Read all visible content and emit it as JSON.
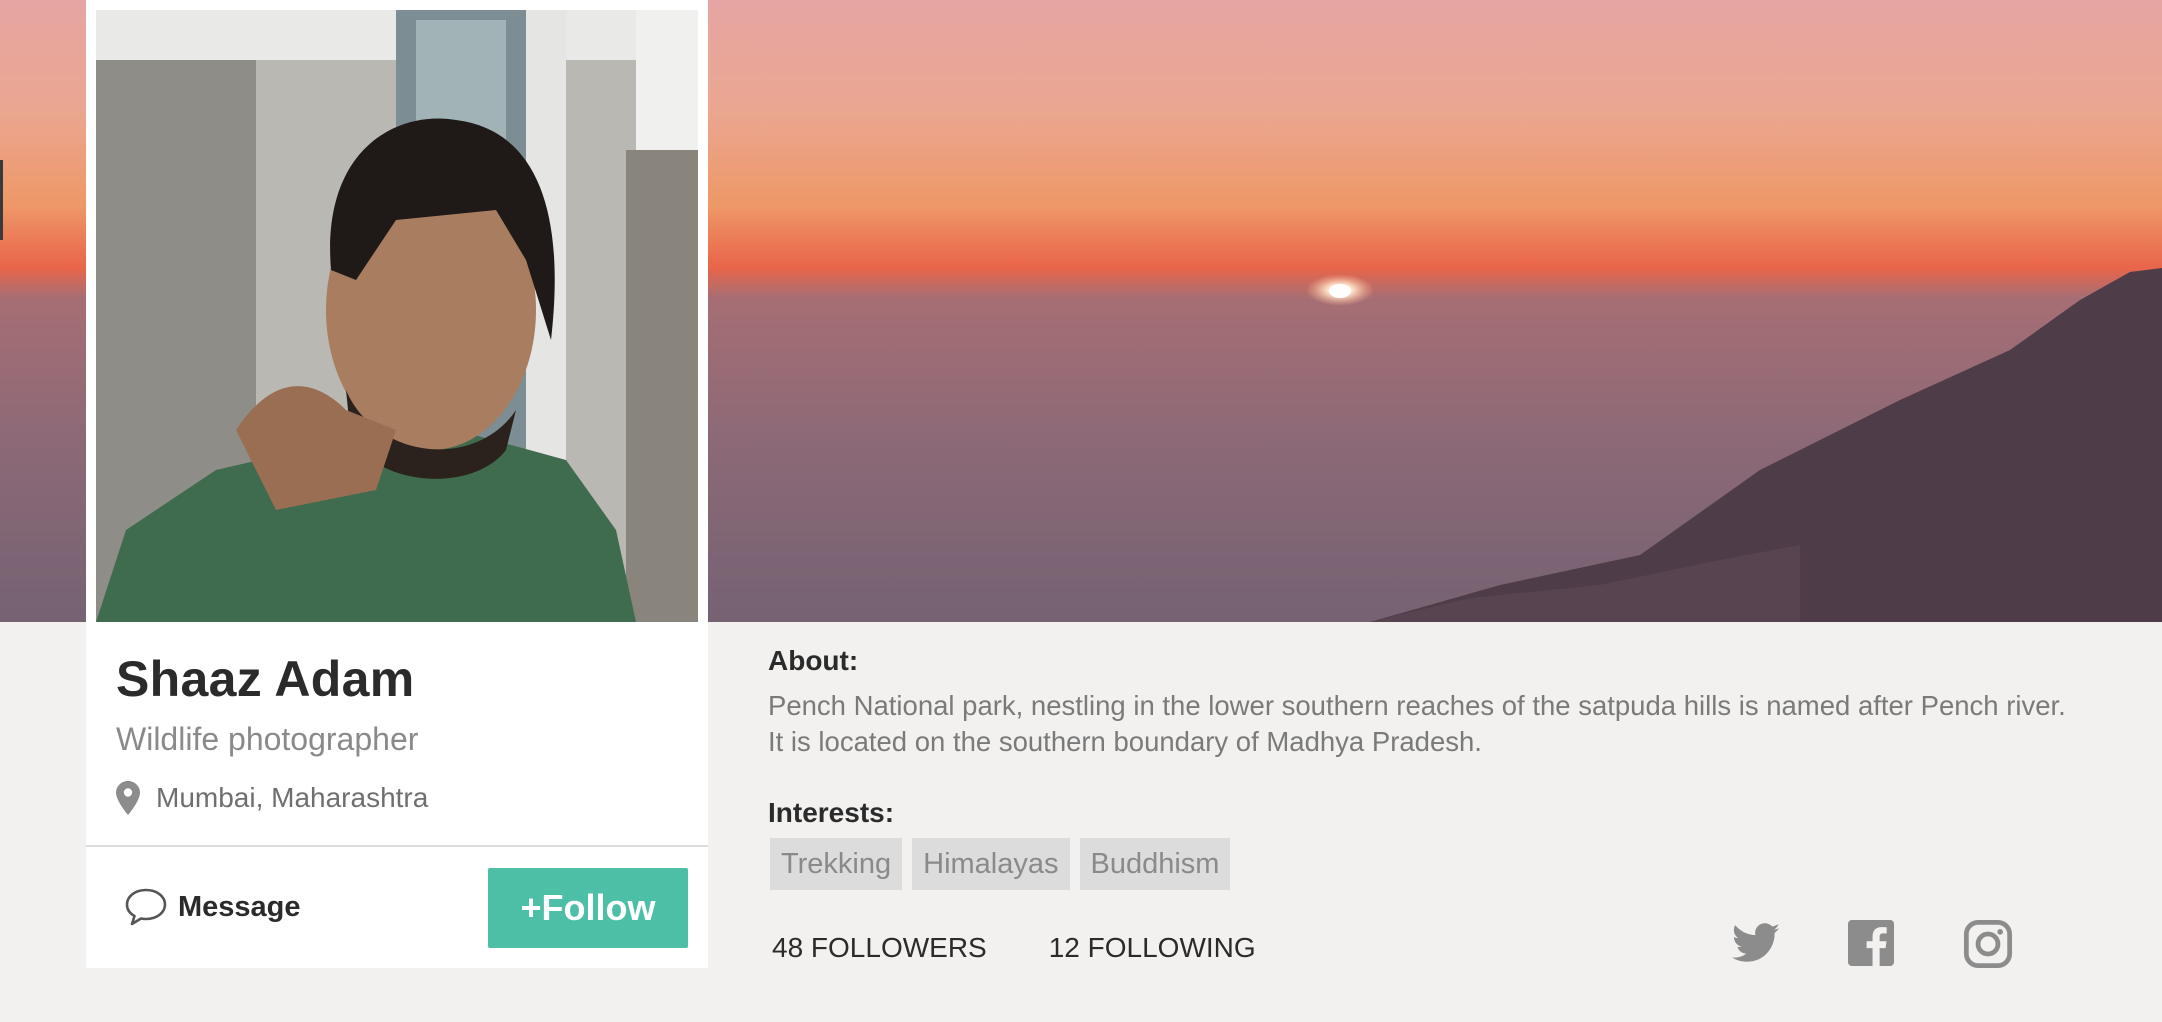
{
  "profile": {
    "name": "Shaaz Adam",
    "occupation": "Wildlife photographer",
    "location": "Mumbai, Maharashtra"
  },
  "actions": {
    "message_label": "Message",
    "follow_label": "+Follow"
  },
  "about": {
    "title": "About:",
    "text": "Pench National park, nestling in the lower southern reaches of the satpuda hills is named after Pench river. It is located on the southern boundary of Madhya Pradesh."
  },
  "interests": {
    "title": "Interests:",
    "tags": [
      "Trekking",
      "Himalayas",
      "Buddhism"
    ]
  },
  "stats": {
    "followers": "48 FOLLOWERS",
    "following": "12 FOLLOWING"
  },
  "social": {
    "icons": [
      "twitter-icon",
      "facebook-icon",
      "instagram-icon"
    ]
  },
  "colors": {
    "accent": "#4cbfa6",
    "background": "#f2f1ef",
    "tag_background": "#dcdcdc",
    "icon_gray": "#8c8c8c"
  }
}
